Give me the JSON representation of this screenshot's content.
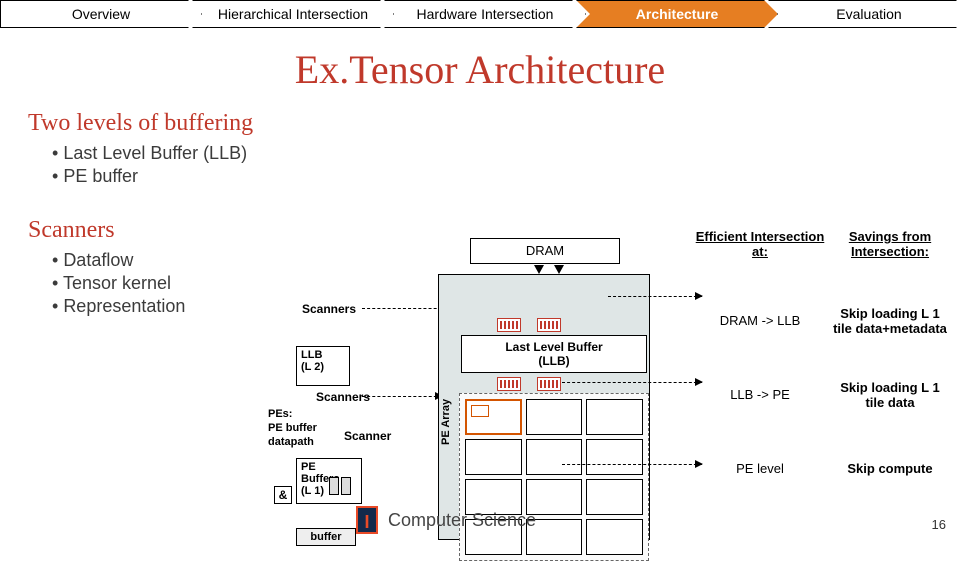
{
  "nav": {
    "items": [
      {
        "label": "Overview"
      },
      {
        "label": "Hierarchical Intersection"
      },
      {
        "label": "Hardware Intersection"
      },
      {
        "label": "Architecture"
      },
      {
        "label": "Evaluation"
      }
    ],
    "active_index": 3
  },
  "title": "Ex.Tensor Architecture",
  "left": {
    "buffering_heading": "Two levels of buffering",
    "buffering_items": [
      "Last Level Buffer (LLB)",
      "PE buffer"
    ],
    "scanners_heading": "Scanners",
    "scanners_items": [
      "Dataflow",
      "Tensor kernel",
      "Representation"
    ]
  },
  "mid": {
    "scanners_label": "Scanners",
    "llb_box_l1": "LLB",
    "llb_box_l2": "(L 2)",
    "scanners_label2": "Scanners",
    "pes_l1": "PEs:",
    "pes_l2": "PE buffer",
    "pes_l3": "datapath",
    "scanner_label3": "Scanner",
    "pebuf_l1": "PE Buffers",
    "pebuf_l2": "(L 1)",
    "amp": "&",
    "buffer": "buffer"
  },
  "diagram": {
    "dram": "DRAM",
    "llb_l1": "Last Level Buffer",
    "llb_l2": "(LLB)",
    "pe_array": "PE Array"
  },
  "right": {
    "col1_head": "Efficient Intersection at:",
    "col2_head": "Savings from Intersection:",
    "rows": [
      {
        "c1": "DRAM -> LLB",
        "c2": "Skip loading L 1 tile data+metadata"
      },
      {
        "c1": "LLB -> PE",
        "c2": "Skip loading L 1 tile data"
      },
      {
        "c1": "PE level",
        "c2": "Skip compute"
      }
    ]
  },
  "footer": {
    "dept": "Computer Science",
    "page": "16",
    "I": "I"
  }
}
